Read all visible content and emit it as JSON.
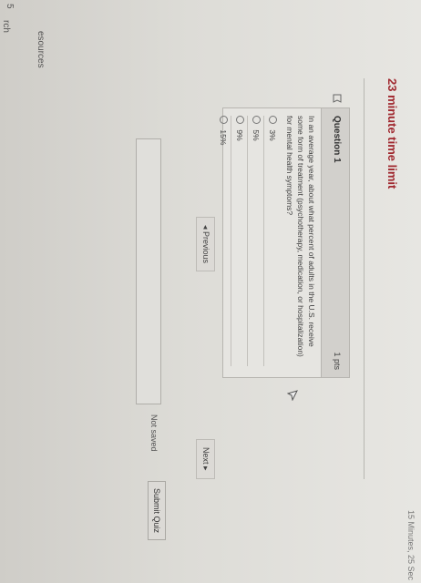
{
  "top_timer": "15 Minutes, 25 Sec",
  "left_edge": {
    "line1": "5",
    "line2": "rch",
    "line3": "esources"
  },
  "quiz": {
    "time_limit": "23 minute time limit",
    "question_title": "Question 1",
    "points": "1 pts",
    "question_text": "In an average year, about what percent of adults in the U.S. receive some form of treatment (psychotherapy, medication, or hospitalization) for mental health symptoms?",
    "options": [
      "3%",
      "5%",
      "9%",
      "15%"
    ]
  },
  "nav": {
    "previous": "◂ Previous",
    "next": "Next ▸"
  },
  "footer": {
    "status": "Not saved",
    "submit": "Submit Quiz"
  }
}
